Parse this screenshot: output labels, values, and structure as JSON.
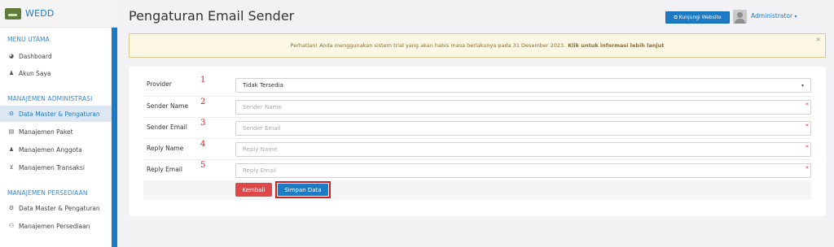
{
  "sidebar": {
    "brand": "WEDD",
    "sections": [
      {
        "title": "MENU UTAMA"
      },
      {
        "title": "MANAJEMEN ADMINISTRASI"
      },
      {
        "title": "MANAJEMEN PERSEDIAAN"
      }
    ],
    "items": [
      {
        "label": "Dashboard",
        "icon": "palette-icon"
      },
      {
        "label": "Akun Saya",
        "icon": "user-icon"
      },
      {
        "label": "Data Master & Pengaturan",
        "icon": "cogs-icon",
        "active": true
      },
      {
        "label": "Manajemen Paket",
        "icon": "book-icon"
      },
      {
        "label": "Manajemen Anggota",
        "icon": "users-icon"
      },
      {
        "label": "Manajemen Transaksi",
        "icon": "cart-icon"
      },
      {
        "label": "Data Master & Pengaturan",
        "icon": "cogs-icon"
      },
      {
        "label": "Manajemen Persediaan",
        "icon": "handshake-icon"
      }
    ]
  },
  "header": {
    "title": "Pengaturan Email Sender",
    "visit_button": "Kunjungi Website",
    "user_name": "Administrator",
    "accent": "#1c7bc4"
  },
  "alert": {
    "message": "Perhatian! Anda menggunakan sistem trial yang akan habis masa berlakunya pada 31 Desember 2023.",
    "link": "Klik untuk informasi lebih lanjut",
    "close": "×"
  },
  "form": {
    "fields": [
      {
        "label": "Provider",
        "annotation": "1",
        "value": "Tidak Tersedia",
        "placeholder": ""
      },
      {
        "label": "Sender Name",
        "annotation": "2",
        "value": "",
        "placeholder": "Sender Name"
      },
      {
        "label": "Sender Email",
        "annotation": "3",
        "value": "",
        "placeholder": "Sender Email"
      },
      {
        "label": "Reply Name",
        "annotation": "4",
        "value": "",
        "placeholder": "Reply Name"
      },
      {
        "label": "Reply Email",
        "annotation": "5",
        "value": "",
        "placeholder": "Reply Email"
      }
    ],
    "required_mark": "*",
    "back_button": "Kembali",
    "save_button": "Simpan Data"
  }
}
